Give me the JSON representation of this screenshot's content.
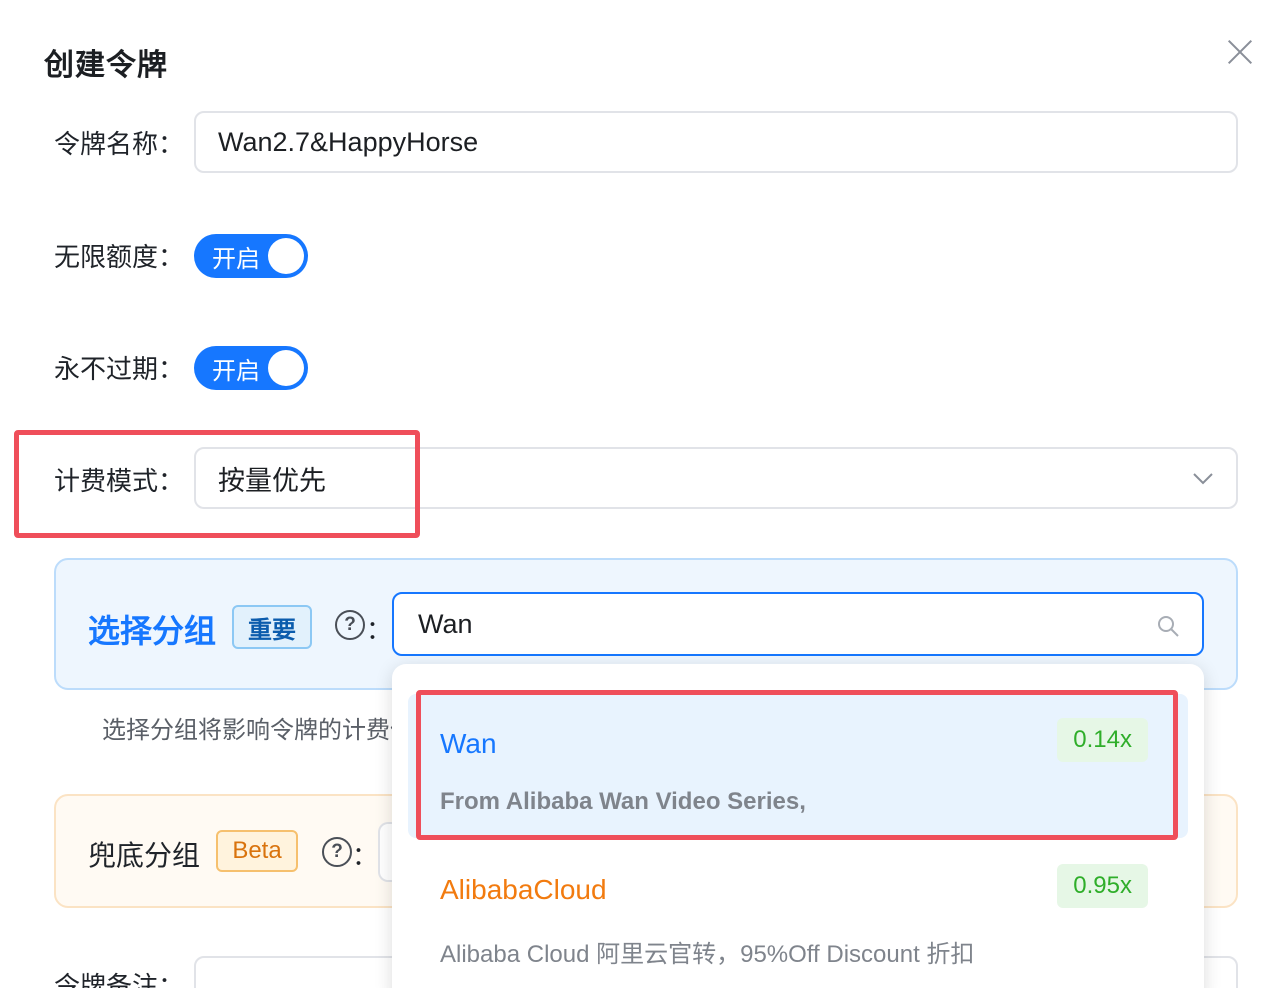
{
  "modal": {
    "title": "创建令牌"
  },
  "fields": {
    "token_name": {
      "label": "令牌名称：",
      "value": "Wan2.7&HappyHorse"
    },
    "unlimited_quota": {
      "label": "无限额度：",
      "switch_text": "开启"
    },
    "never_expire": {
      "label": "永不过期：",
      "switch_text": "开启"
    },
    "billing_mode": {
      "label": "计费模式：",
      "value": "按量优先"
    }
  },
  "group": {
    "title": "选择分组",
    "badge": "重要",
    "help": "?",
    "colon": "：",
    "search_value": "Wan",
    "hint": "选择分组将影响令牌的计费倍率与可用模型"
  },
  "fallback": {
    "title": "兜底分组",
    "badge": "Beta",
    "help": "?",
    "colon": "："
  },
  "note": {
    "label": "令牌备注："
  },
  "dropdown": {
    "options": [
      {
        "name": "Wan",
        "ratio": "0.14x",
        "desc": "From Alibaba Wan Video Series,",
        "name_color": "#1677ff"
      },
      {
        "name": "AlibabaCloud",
        "ratio": "0.95x",
        "desc": "Alibaba Cloud 阿里云官转，95%Off Discount 折扣",
        "name_color": "#f27b0f"
      }
    ]
  }
}
